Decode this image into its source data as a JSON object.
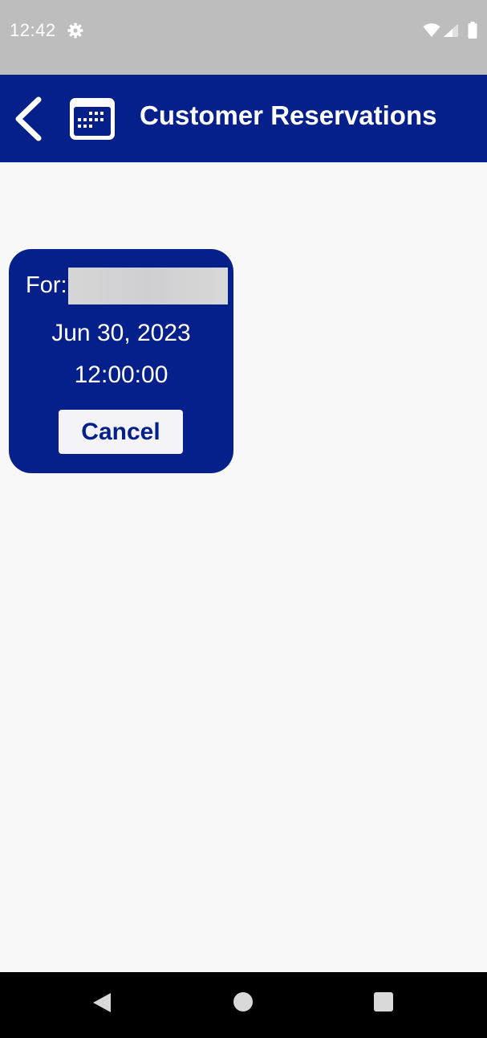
{
  "status_bar": {
    "time": "12:42",
    "icons": [
      "gear-icon",
      "wifi-icon",
      "signal-icon",
      "battery-icon"
    ]
  },
  "app_bar": {
    "title": "Customer Reservations",
    "back_icon": "chevron-left-icon",
    "title_icon": "calendar-icon",
    "background_color": "#05208a"
  },
  "reservations": [
    {
      "for_label": "For:",
      "customer_name": "",
      "date": "Jun 30, 2023",
      "time": "12:00:00",
      "cancel_label": "Cancel"
    }
  ],
  "nav_bar": {
    "icons": [
      "nav-back-icon",
      "nav-home-icon",
      "nav-recents-icon"
    ]
  },
  "colors": {
    "primary": "#05208a",
    "background": "#f8f8f8",
    "status_bar": "#bdbdbd",
    "button_bg": "#f4f4f8",
    "button_text": "#06208a"
  }
}
